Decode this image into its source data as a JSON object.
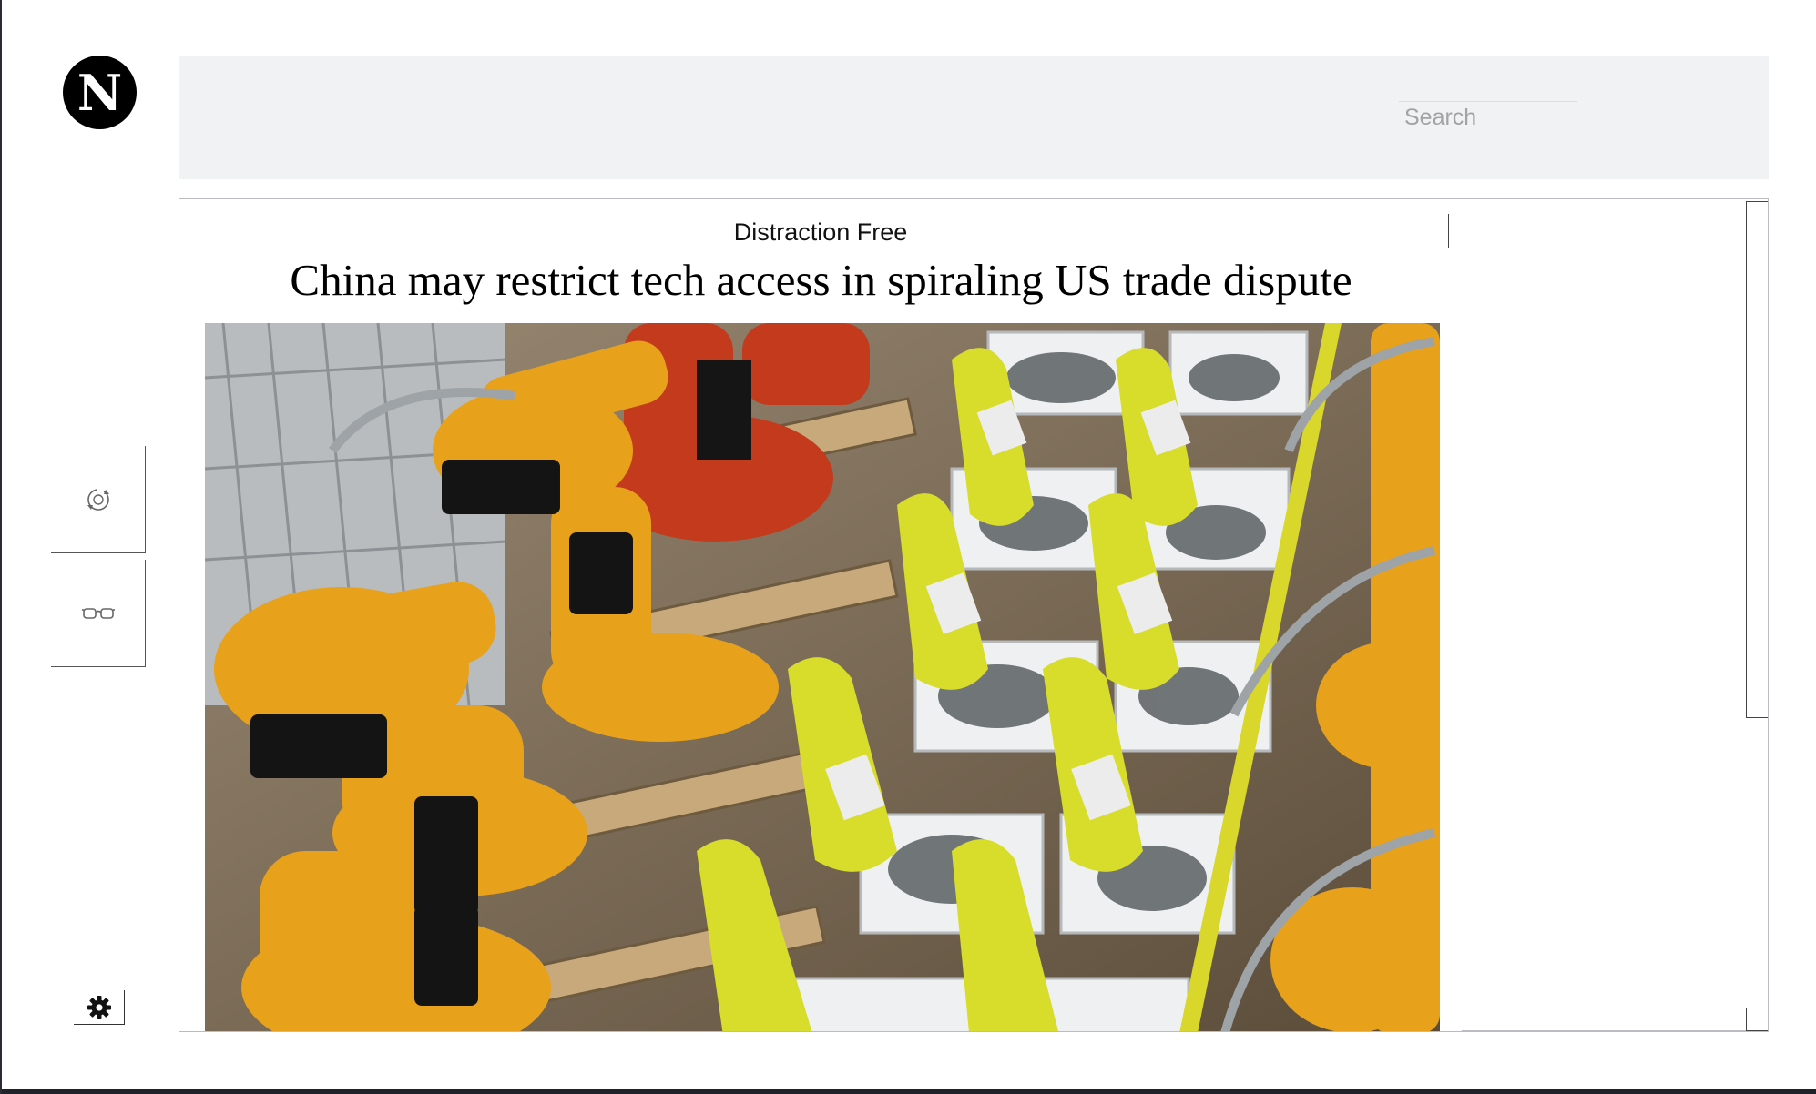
{
  "app": {
    "logo_letter": "N"
  },
  "header": {
    "search_placeholder": "Search"
  },
  "sidebar": {
    "buttons": [
      {
        "name": "refresh-view",
        "icon": "refresh-icon"
      },
      {
        "name": "reader-mode",
        "icon": "glasses-icon"
      }
    ],
    "settings_icon": "gear-icon"
  },
  "article": {
    "mode_label": "Distraction Free",
    "headline": "China may restrict tech access in spiraling US trade dispute",
    "image_subject": "factory-robot-arms-photo"
  },
  "colors": {
    "topbar_bg": "#f1f2f4",
    "logo_bg": "#000000",
    "robot_orange": "#e8a11a",
    "robot_yellow": "#d8dc2a",
    "robot_red": "#c43a1c"
  }
}
